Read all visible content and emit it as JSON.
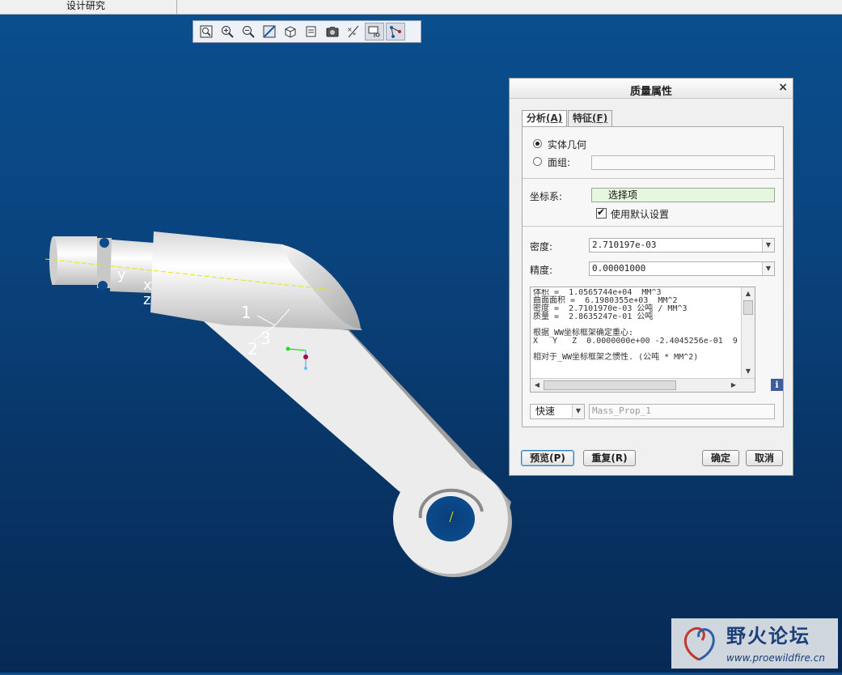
{
  "menubar": {
    "tab_label": "设计研究"
  },
  "toolbar": {
    "buttons": [
      {
        "name": "refit-zoom-icon"
      },
      {
        "name": "zoom-in-icon"
      },
      {
        "name": "zoom-out-icon"
      },
      {
        "name": "reorient-icon"
      },
      {
        "name": "display-style-icon"
      },
      {
        "name": "saved-views-icon"
      },
      {
        "name": "view-manager-icon"
      },
      {
        "name": "datum-display-icon"
      },
      {
        "name": "annotation-display-icon"
      },
      {
        "name": "point-display-icon"
      }
    ]
  },
  "viewport": {
    "csys_labels": {
      "y": "y",
      "x": "x",
      "z": "z",
      "n1": "1",
      "n2": "2",
      "n3": "3"
    }
  },
  "dialog": {
    "title": "质量属性",
    "close": "×",
    "tabs": [
      {
        "label": "分析",
        "mnemonic": "(A)",
        "selected": true
      },
      {
        "label": "特征",
        "mnemonic": "(F)",
        "selected": false
      }
    ],
    "solid_geometry": {
      "label": "实体几何",
      "selected": true
    },
    "quilt": {
      "label": "面组:",
      "value": ""
    },
    "csys": {
      "label": "坐标系:",
      "value": "选择项"
    },
    "use_default": {
      "label": "使用默认设置",
      "checked": true
    },
    "density": {
      "label": "密度:",
      "value": "2.710197e-03"
    },
    "accuracy": {
      "label": "精度:",
      "value": "0.00001000"
    },
    "results_lines": [
      "体积 =  1.0565744e+04  MM^3",
      "曲面面积 =  6.1980355e+03  MM^2",
      "密度 =  2.7101970e-03 公吨 / MM^3",
      "质量 =  2.8635247e-01 公吨",
      "",
      "根据_WW坐标框架确定重心:",
      "X   Y   Z  0.0000000e+00 -2.4045256e-01  9",
      "",
      "相对于_WW坐标框架之惯性. (公吨 * MM^2)"
    ],
    "info_label": "i",
    "mode": {
      "value": "快速"
    },
    "name_field": {
      "value": "Mass_Prop_1"
    },
    "buttons": {
      "preview": "预览(P)",
      "repeat": "重复(R)",
      "ok": "确定",
      "cancel": "取消"
    }
  },
  "watermark": {
    "title": "野火论坛",
    "url": "www.proewildfire.cn"
  }
}
